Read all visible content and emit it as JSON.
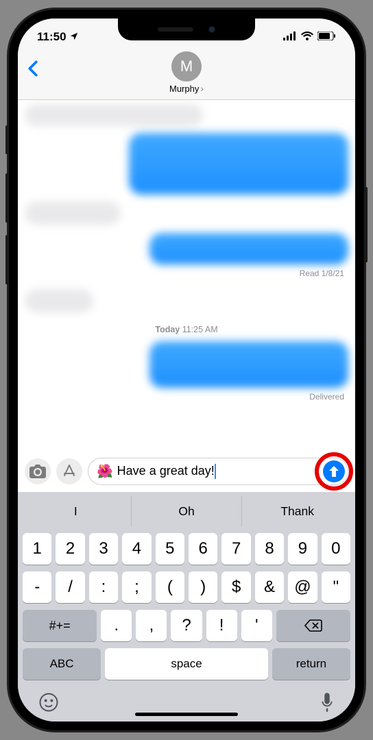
{
  "status": {
    "time": "11:50",
    "location_icon": "➤"
  },
  "header": {
    "contact_initial": "M",
    "contact_name": "Murphy"
  },
  "conversation": {
    "read_status": "Read 1/8/21",
    "timestamp_day": "Today",
    "timestamp_time": "11:25 AM",
    "delivered_status": "Delivered"
  },
  "input": {
    "emoji": "🌺",
    "text": "Have a great day!"
  },
  "predictions": [
    "I",
    "Oh",
    "Thank"
  ],
  "keyboard": {
    "row1": [
      "1",
      "2",
      "3",
      "4",
      "5",
      "6",
      "7",
      "8",
      "9",
      "0"
    ],
    "row2": [
      "-",
      "/",
      ":",
      ";",
      "(",
      ")",
      "$",
      "&",
      "@",
      "\""
    ],
    "row3": [
      ".",
      ",",
      "?",
      "!",
      "'"
    ],
    "shift": "#+=",
    "abc": "ABC",
    "space": "space",
    "return": "return"
  }
}
